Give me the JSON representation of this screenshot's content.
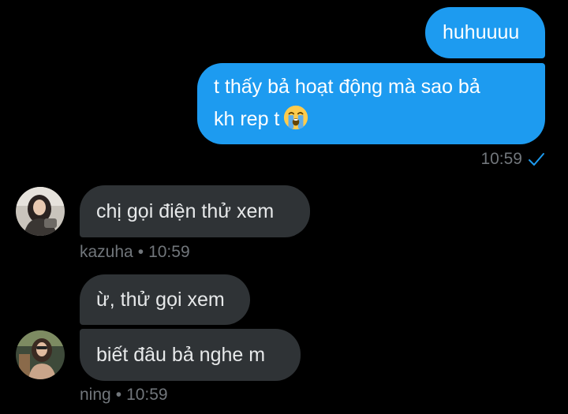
{
  "messages": {
    "outgoing_1": "huhuuuu",
    "outgoing_2_line1": "t thấy bả hoạt động mà sao bả",
    "outgoing_2_line2": "kh rep t",
    "incoming_1": "chị gọi điện thử xem",
    "incoming_2": "ừ, thử gọi xem",
    "incoming_3": "biết đâu bả nghe m"
  },
  "meta": {
    "outgoing_time": "10:59",
    "sender_1": "kazuha",
    "sender_1_time": "10:59",
    "sender_2": "ning",
    "sender_2_time": "10:59",
    "separator": "•"
  },
  "icons": {
    "sent_status": "checkmark-icon",
    "emoji": "loudly-crying-face-icon"
  },
  "colors": {
    "background": "#000000",
    "outgoing_bubble": "#1d9bf0",
    "incoming_bubble": "#2f3336",
    "meta_text": "#71767b",
    "check": "#1d9bf0"
  }
}
